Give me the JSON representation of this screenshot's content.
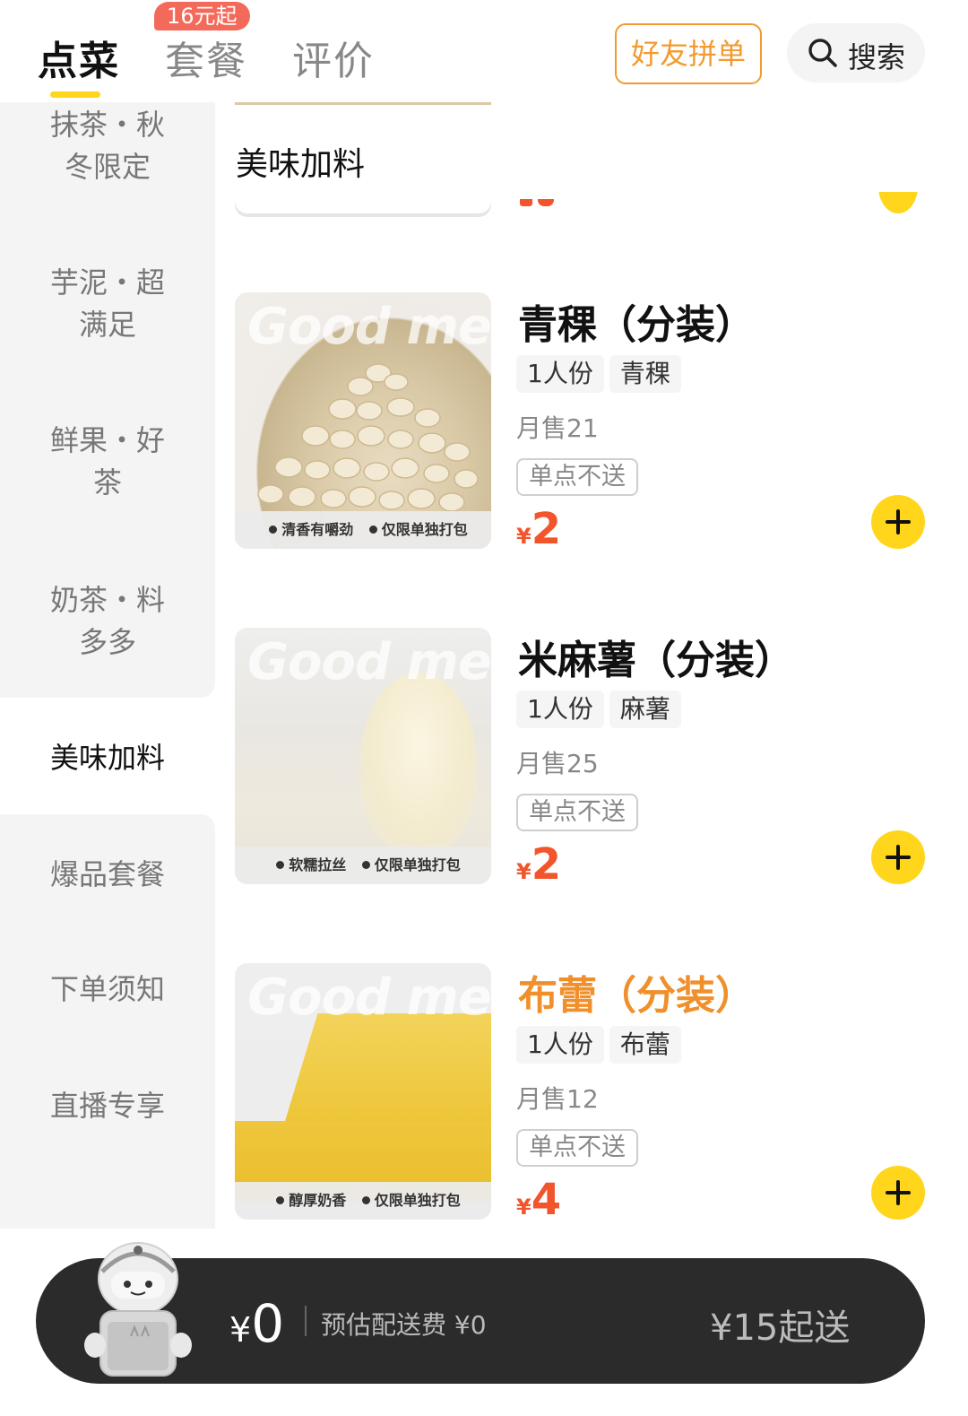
{
  "header": {
    "tabs": [
      {
        "label": "点菜"
      },
      {
        "label": "套餐"
      },
      {
        "label": "评价"
      }
    ],
    "badge": "16元起",
    "friends_button": "好友拼单",
    "search_label": "搜索"
  },
  "sidebar": {
    "items": [
      {
        "label": "抹茶・秋冬限定"
      },
      {
        "label": "芋泥・超满足"
      },
      {
        "label": "鲜果・好茶"
      },
      {
        "label": "奶茶・料多多"
      },
      {
        "label": "美味加料"
      },
      {
        "label": "爆品套餐"
      },
      {
        "label": "下单须知"
      },
      {
        "label": "直播专享"
      }
    ],
    "active_index": 4
  },
  "section": {
    "title": "美味加料"
  },
  "products": [
    {
      "name": "青稞（分装）",
      "tags": [
        "1人份",
        "青稞"
      ],
      "sold": "月售21",
      "notice": "单点不送",
      "currency": "¥",
      "price": "2",
      "image_brand": "Good me",
      "image_captions": [
        "清香有嚼劲",
        "仅限单独打包"
      ],
      "name_color": "#111111"
    },
    {
      "name": "米麻薯（分装）",
      "tags": [
        "1人份",
        "麻薯"
      ],
      "sold": "月售25",
      "notice": "单点不送",
      "currency": "¥",
      "price": "2",
      "image_brand": "Good me",
      "image_captions": [
        "软糯拉丝",
        "仅限单独打包"
      ],
      "name_color": "#111111"
    },
    {
      "name": "布蕾（分装）",
      "tags": [
        "1人份",
        "布蕾"
      ],
      "sold": "月售12",
      "notice": "单点不送",
      "currency": "¥",
      "price": "4",
      "image_brand": "Good me",
      "image_captions": [
        "醇厚奶香",
        "仅限单独打包"
      ],
      "name_color": "#f0902c"
    }
  ],
  "cart": {
    "currency": "¥",
    "amount": "0",
    "fee": "预估配送费 ¥0",
    "minimum": "¥15起送"
  },
  "colors": {
    "accent_yellow": "#ffd61c",
    "price_red": "#f2552c",
    "friends_orange": "#f39a2e",
    "badge_red": "#f46a5a"
  }
}
